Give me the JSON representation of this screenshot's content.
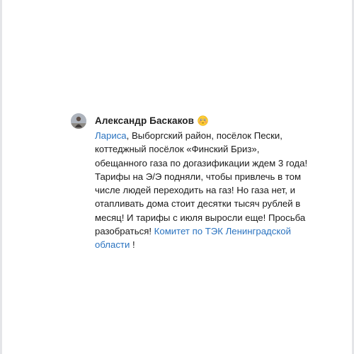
{
  "comment": {
    "author": "Александр Баскаков",
    "author_emoji": "flushed-face-emoji",
    "mention_user": "Лариса",
    "text_part1": ", Выборгский район, посёлок Пески, коттеджный посёлок «Финский Бриз», обещанного газа по догазификации ждем 3 года! Тарифы на Э/Э подняли, чтобы привлечь в том числе людей переходить на газ! Но газа нет, и отапливать дома стоит десятки тысяч рублей в месяц! И тарифы с июля выросли еще! Просьба разобраться! ",
    "mention_group": "Комитет по ТЭК Ленинградской области",
    "text_part2": " !"
  },
  "colors": {
    "link": "#2a73c0",
    "text": "#1a1a1a",
    "border": "#e4e5e8"
  }
}
